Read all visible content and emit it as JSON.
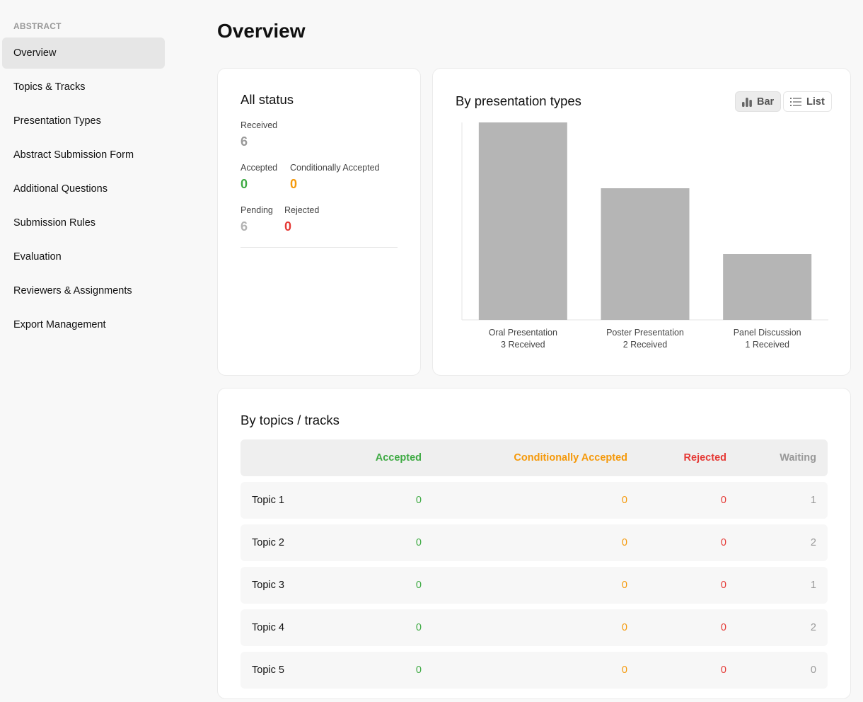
{
  "sidebar": {
    "section_label": "ABSTRACT",
    "items": [
      {
        "label": "Overview",
        "active": true
      },
      {
        "label": "Topics & Tracks"
      },
      {
        "label": "Presentation Types"
      },
      {
        "label": "Abstract Submission Form"
      },
      {
        "label": "Additional Questions"
      },
      {
        "label": "Submission Rules"
      },
      {
        "label": "Evaluation"
      },
      {
        "label": "Reviewers & Assignments"
      },
      {
        "label": "Export Management"
      }
    ]
  },
  "header": {
    "title": "Overview"
  },
  "all_status": {
    "title": "All status",
    "received": {
      "label": "Received",
      "value": "6"
    },
    "accepted": {
      "label": "Accepted",
      "value": "0"
    },
    "conditionally_accepted": {
      "label": "Conditionally Accepted",
      "value": "0"
    },
    "pending": {
      "label": "Pending",
      "value": "6"
    },
    "rejected": {
      "label": "Rejected",
      "value": "0"
    }
  },
  "presentation_types": {
    "title": "By presentation types",
    "view_toggle": {
      "bar_label": "Bar",
      "list_label": "List",
      "selected": "Bar"
    }
  },
  "chart_data": {
    "type": "bar",
    "title": "By presentation types",
    "categories": [
      "Oral Presentation",
      "Poster Presentation",
      "Panel Discussion"
    ],
    "values": [
      3,
      2,
      1
    ],
    "data_labels": [
      "3 Received",
      "2 Received",
      "1 Received"
    ],
    "xlabel": "",
    "ylabel": "",
    "ylim": [
      0,
      3
    ],
    "grid": false,
    "bar_color": "#b5b5b5"
  },
  "topics": {
    "title": "By topics / tracks",
    "columns": [
      "",
      "Accepted",
      "Conditionally Accepted",
      "Rejected",
      "Waiting"
    ],
    "rows": [
      {
        "name": "Topic 1",
        "accepted": "0",
        "conditionally_accepted": "0",
        "rejected": "0",
        "waiting": "1"
      },
      {
        "name": "Topic 2",
        "accepted": "0",
        "conditionally_accepted": "0",
        "rejected": "0",
        "waiting": "2"
      },
      {
        "name": "Topic 3",
        "accepted": "0",
        "conditionally_accepted": "0",
        "rejected": "0",
        "waiting": "1"
      },
      {
        "name": "Topic 4",
        "accepted": "0",
        "conditionally_accepted": "0",
        "rejected": "0",
        "waiting": "2"
      },
      {
        "name": "Topic 5",
        "accepted": "0",
        "conditionally_accepted": "0",
        "rejected": "0",
        "waiting": "0"
      }
    ]
  },
  "colors": {
    "accepted": "#3eaa43",
    "conditionally_accepted": "#f5990a",
    "rejected": "#e53935",
    "waiting": "#999999"
  }
}
